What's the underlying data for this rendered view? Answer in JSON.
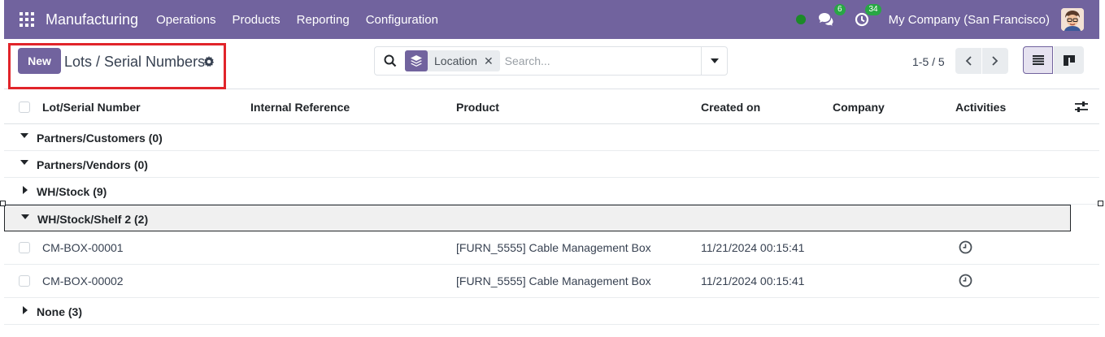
{
  "navbar": {
    "brand": "Manufacturing",
    "menu": [
      "Operations",
      "Products",
      "Reporting",
      "Configuration"
    ],
    "messages_count": "6",
    "activities_count": "34",
    "company": "My Company (San Francisco)",
    "accent_color": "#71639e"
  },
  "control": {
    "new_label": "New",
    "title": "Lots / Serial Numbers",
    "search": {
      "facet_label": "Location",
      "facet_icon": "layers-icon",
      "placeholder": "Search..."
    },
    "pager": "1-5 / 5"
  },
  "table": {
    "columns": [
      "Lot/Serial Number",
      "Internal Reference",
      "Product",
      "Created on",
      "Company",
      "Activities"
    ],
    "groups": [
      {
        "label": "Partners/Customers (0)",
        "expanded": true
      },
      {
        "label": "Partners/Vendors (0)",
        "expanded": true
      },
      {
        "label": "WH/Stock (9)",
        "expanded": false
      },
      {
        "label": "WH/Stock/Shelf 2 (2)",
        "expanded": true
      },
      {
        "label": "None (3)",
        "expanded": false
      }
    ],
    "rows": [
      {
        "lot": "CM-BOX-00001",
        "product": "[FURN_5555] Cable Management Box",
        "created": "11/21/2024 00:15:41"
      },
      {
        "lot": "CM-BOX-00002",
        "product": "[FURN_5555] Cable Management Box",
        "created": "11/21/2024 00:15:41"
      }
    ]
  }
}
